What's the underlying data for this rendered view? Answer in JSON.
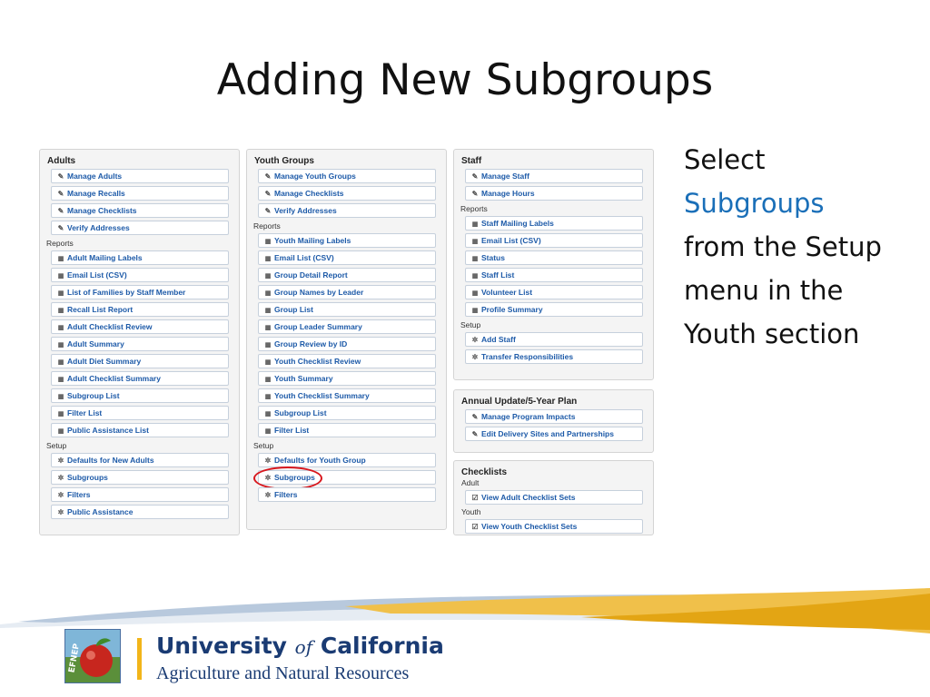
{
  "slide": {
    "title": "Adding New Subgroups",
    "instruction": {
      "line1": "Select",
      "line2": "Subgroups",
      "line3": "from the Setup",
      "line4": "menu in the",
      "line5": "Youth section"
    }
  },
  "panels": {
    "adults": {
      "title": "Adults",
      "manage": [
        "Manage Adults",
        "Manage Recalls",
        "Manage Checklists",
        "Verify Addresses"
      ],
      "reports_label": "Reports",
      "reports": [
        "Adult Mailing Labels",
        "Email List (CSV)",
        "List of Families by Staff Member",
        "Recall List Report",
        "Adult Checklist Review",
        "Adult Summary",
        "Adult Diet Summary",
        "Adult Checklist Summary",
        "Subgroup List",
        "Filter List",
        "Public Assistance List"
      ],
      "setup_label": "Setup",
      "setup": [
        "Defaults for New Adults",
        "Subgroups",
        "Filters",
        "Public Assistance"
      ]
    },
    "youth": {
      "title": "Youth Groups",
      "manage": [
        "Manage Youth Groups",
        "Manage Checklists",
        "Verify Addresses"
      ],
      "reports_label": "Reports",
      "reports": [
        "Youth Mailing Labels",
        "Email List (CSV)",
        "Group Detail Report",
        "Group Names by Leader",
        "Group List",
        "Group Leader Summary",
        "Group Review by ID",
        "Youth Checklist Review",
        "Youth Summary",
        "Youth Checklist Summary",
        "Subgroup List",
        "Filter List"
      ],
      "setup_label": "Setup",
      "setup": [
        "Defaults for Youth Group",
        "Subgroups",
        "Filters"
      ]
    },
    "staff": {
      "title": "Staff",
      "manage": [
        "Manage Staff",
        "Manage Hours"
      ],
      "reports_label": "Reports",
      "reports": [
        "Staff Mailing Labels",
        "Email List (CSV)",
        "Status",
        "Staff List",
        "Volunteer List",
        "Profile Summary"
      ],
      "setup_label": "Setup",
      "setup": [
        "Add Staff",
        "Transfer Responsibilities"
      ]
    },
    "annual": {
      "title": "Annual Update/5-Year Plan",
      "manage": [
        "Manage Program Impacts",
        "Edit Delivery Sites and Partnerships"
      ]
    },
    "checklists": {
      "title": "Checklists",
      "adult_label": "Adult",
      "adult_item": "View Adult Checklist Sets",
      "youth_label": "Youth",
      "youth_item": "View Youth Checklist Sets"
    }
  },
  "footer": {
    "org_name_part1": "University",
    "org_name_of": "of",
    "org_name_part2": "California",
    "org_division": "Agriculture and Natural Resources",
    "logo_text": "EFNEP"
  },
  "colors": {
    "link": "#1d5aa8",
    "accent_text": "#1a6fb8",
    "highlight_ring": "#d8161c",
    "org_navy": "#1a3b73",
    "org_gold": "#f2b51a"
  },
  "icons": {
    "manage": "pencil-icon",
    "reports": "report-icon",
    "setup": "gear-icon",
    "checklists": "checklist-icon"
  }
}
